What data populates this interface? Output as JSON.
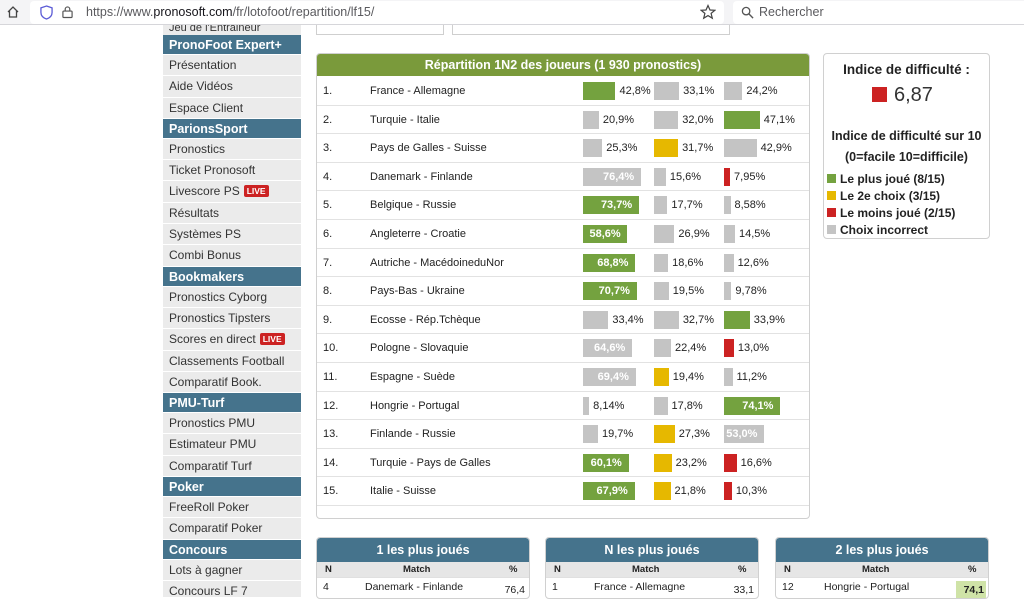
{
  "browser": {
    "url_prefix": "https://www.",
    "url_domain": "pronosoft.com",
    "url_path": "/fr/lotofoot/repartition/lf15/",
    "search_placeholder": "Rechercher"
  },
  "sidebar": {
    "cut_top": "Jeu de l'Entraineur",
    "sections": [
      {
        "title": "PronoFoot Expert+",
        "items": [
          "Présentation",
          "Aide Vidéos",
          "Espace Client"
        ]
      },
      {
        "title": "ParionsSport",
        "items": [
          "Pronostics",
          "Ticket Pronosoft",
          "Livescore PS",
          "Résultats",
          "Systèmes PS",
          "Combi Bonus"
        ]
      },
      {
        "title": "Bookmakers",
        "items": [
          "Pronostics Cyborg",
          "Pronostics Tipsters",
          "Scores en direct",
          "Classements Football",
          "Comparatif Book."
        ]
      },
      {
        "title": "PMU-Turf",
        "items": [
          "Pronostics PMU",
          "Estimateur PMU",
          "Comparatif Turf"
        ]
      },
      {
        "title": "Poker",
        "items": [
          "FreeRoll Poker",
          "Comparatif Poker"
        ]
      },
      {
        "title": "Concours",
        "items": [
          "Lots à gagner",
          "Concours LF 7"
        ]
      }
    ],
    "live_label": "LIVE"
  },
  "main": {
    "title": "Répartition 1N2 des joueurs (1 930 pronostics)",
    "colors": {
      "green": "#74a23f",
      "yellow": "#e6b800",
      "red": "#cc2222",
      "grey": "#c4c4c4"
    },
    "matches": [
      {
        "n": "1.",
        "match": "France - Allemagne",
        "p": [
          "42,8%",
          "33,1%",
          "24,2%"
        ],
        "v": [
          42.8,
          33.1,
          24.2
        ],
        "c": [
          "green",
          "grey",
          "grey"
        ]
      },
      {
        "n": "2.",
        "match": "Turquie - Italie",
        "p": [
          "20,9%",
          "32,0%",
          "47,1%"
        ],
        "v": [
          20.9,
          32.0,
          47.1
        ],
        "c": [
          "grey",
          "grey",
          "green"
        ]
      },
      {
        "n": "3.",
        "match": "Pays de Galles - Suisse",
        "p": [
          "25,3%",
          "31,7%",
          "42,9%"
        ],
        "v": [
          25.3,
          31.7,
          42.9
        ],
        "c": [
          "grey",
          "yellow",
          "grey"
        ]
      },
      {
        "n": "4.",
        "match": "Danemark - Finlande",
        "p": [
          "76,4%",
          "15,6%",
          "7,95%"
        ],
        "v": [
          76.4,
          15.6,
          7.95
        ],
        "c": [
          "grey",
          "grey",
          "red"
        ]
      },
      {
        "n": "5.",
        "match": "Belgique - Russie",
        "p": [
          "73,7%",
          "17,7%",
          "8,58%"
        ],
        "v": [
          73.7,
          17.7,
          8.58
        ],
        "c": [
          "green",
          "grey",
          "grey"
        ]
      },
      {
        "n": "6.",
        "match": "Angleterre - Croatie",
        "p": [
          "58,6%",
          "26,9%",
          "14,5%"
        ],
        "v": [
          58.6,
          26.9,
          14.5
        ],
        "c": [
          "green",
          "grey",
          "grey"
        ]
      },
      {
        "n": "7.",
        "match": "Autriche - MacédoineduNor",
        "p": [
          "68,8%",
          "18,6%",
          "12,6%"
        ],
        "v": [
          68.8,
          18.6,
          12.6
        ],
        "c": [
          "green",
          "grey",
          "grey"
        ]
      },
      {
        "n": "8.",
        "match": "Pays-Bas - Ukraine",
        "p": [
          "70,7%",
          "19,5%",
          "9,78%"
        ],
        "v": [
          70.7,
          19.5,
          9.78
        ],
        "c": [
          "green",
          "grey",
          "grey"
        ]
      },
      {
        "n": "9.",
        "match": "Ecosse - Rép.Tchèque",
        "p": [
          "33,4%",
          "32,7%",
          "33,9%"
        ],
        "v": [
          33.4,
          32.7,
          33.9
        ],
        "c": [
          "grey",
          "grey",
          "green"
        ]
      },
      {
        "n": "10.",
        "match": "Pologne - Slovaquie",
        "p": [
          "64,6%",
          "22,4%",
          "13,0%"
        ],
        "v": [
          64.6,
          22.4,
          13.0
        ],
        "c": [
          "grey",
          "grey",
          "red"
        ]
      },
      {
        "n": "11.",
        "match": "Espagne - Suède",
        "p": [
          "69,4%",
          "19,4%",
          "11,2%"
        ],
        "v": [
          69.4,
          19.4,
          11.2
        ],
        "c": [
          "grey",
          "yellow",
          "grey"
        ]
      },
      {
        "n": "12.",
        "match": "Hongrie - Portugal",
        "p": [
          "8,14%",
          "17,8%",
          "74,1%"
        ],
        "v": [
          8.14,
          17.8,
          74.1
        ],
        "c": [
          "grey",
          "grey",
          "green"
        ]
      },
      {
        "n": "13.",
        "match": "Finlande - Russie",
        "p": [
          "19,7%",
          "27,3%",
          "53,0%"
        ],
        "v": [
          19.7,
          27.3,
          53.0
        ],
        "c": [
          "grey",
          "yellow",
          "grey"
        ]
      },
      {
        "n": "14.",
        "match": "Turquie - Pays de Galles",
        "p": [
          "60,1%",
          "23,2%",
          "16,6%"
        ],
        "v": [
          60.1,
          23.2,
          16.6
        ],
        "c": [
          "green",
          "yellow",
          "red"
        ]
      },
      {
        "n": "15.",
        "match": "Italie - Suisse",
        "p": [
          "67,9%",
          "21,8%",
          "10,3%"
        ],
        "v": [
          67.9,
          21.8,
          10.3
        ],
        "c": [
          "green",
          "yellow",
          "red"
        ]
      }
    ]
  },
  "difficulty": {
    "title": "Indice de difficulté :",
    "value": "6,87",
    "subtitle": "Indice de difficulté sur 10",
    "scale": "(0=facile 10=difficile)",
    "legend": [
      {
        "label": "Le plus joué (8/15)",
        "color": "#74a23f"
      },
      {
        "label": "Le 2e choix (3/15)",
        "color": "#e6b800"
      },
      {
        "label": "Le moins joué (2/15)",
        "color": "#cc2222"
      },
      {
        "label": "Choix incorrect",
        "color": "#c4c4c4"
      }
    ]
  },
  "bottom": [
    {
      "title": "1 les plus joués",
      "cols": [
        "N",
        "Match",
        "%"
      ],
      "row": [
        "4",
        "Danemark - Finlande",
        "76,4"
      ],
      "hl": false
    },
    {
      "title": "N les plus joués",
      "cols": [
        "N",
        "Match",
        "%"
      ],
      "row": [
        "1",
        "France - Allemagne",
        "33,1"
      ],
      "hl": false
    },
    {
      "title": "2 les plus joués",
      "cols": [
        "N",
        "Match",
        "%"
      ],
      "row": [
        "12",
        "Hongrie - Portugal",
        "74,1"
      ],
      "hl": true
    }
  ]
}
